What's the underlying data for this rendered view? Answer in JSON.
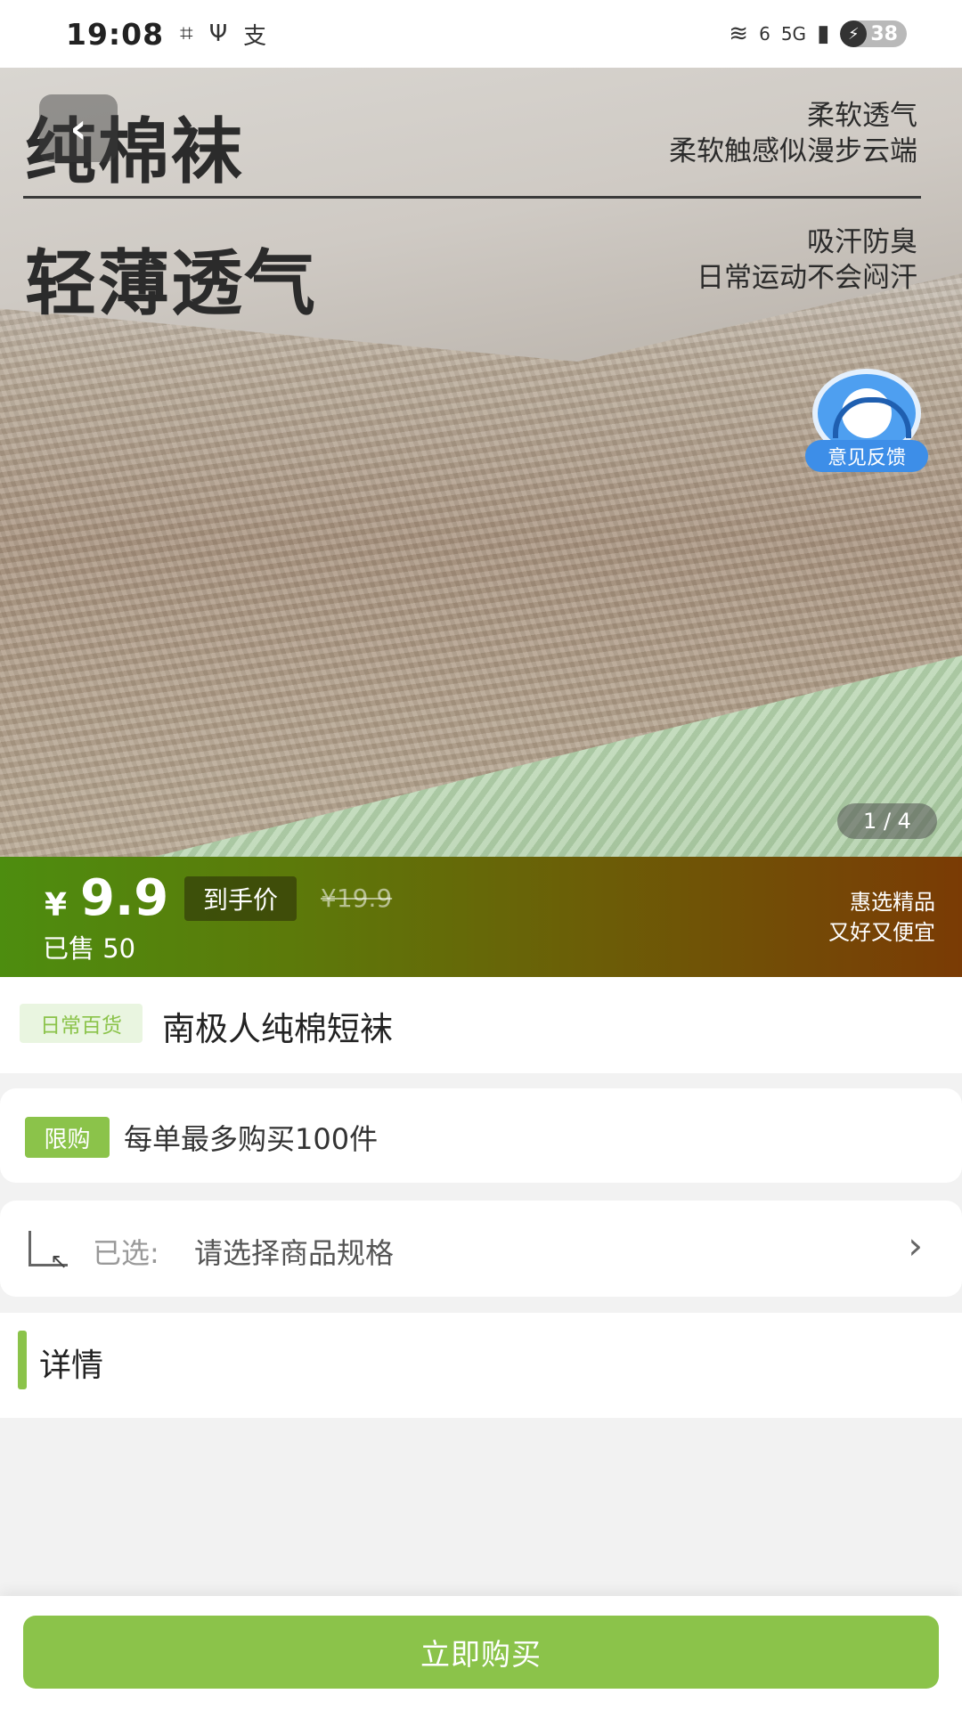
{
  "status_bar": {
    "time": "19:08",
    "network": "5G",
    "wifi_level": "6",
    "battery": "38"
  },
  "hero": {
    "title_line1": "纯棉袜",
    "title_line2": "轻薄透气",
    "sub1_line1": "柔软透气",
    "sub1_line2": "柔软触感似漫步云端",
    "sub2_line1": "吸汗防臭",
    "sub2_line2": "日常运动不会闷汗",
    "feedback_label": "意见反馈",
    "pager": "1 / 4"
  },
  "price": {
    "currency": "¥",
    "value": "9.9",
    "tag": "到手价",
    "original": "¥19.9",
    "sold": "已售 50",
    "promo_line1": "惠选精品",
    "promo_line2": "又好又便宜"
  },
  "product": {
    "category": "日常百货",
    "name": "南极人纯棉短袜"
  },
  "limit": {
    "badge": "限购",
    "text": "每单最多购买100件"
  },
  "spec": {
    "label": "已选:",
    "value": "请选择商品规格"
  },
  "details": {
    "title": "详情"
  },
  "bottom": {
    "buy_label": "立即购买"
  },
  "colors": {
    "accent": "#8bc34a",
    "price_gradient_start": "#4d8d0f",
    "price_gradient_end": "#7a3b05"
  }
}
